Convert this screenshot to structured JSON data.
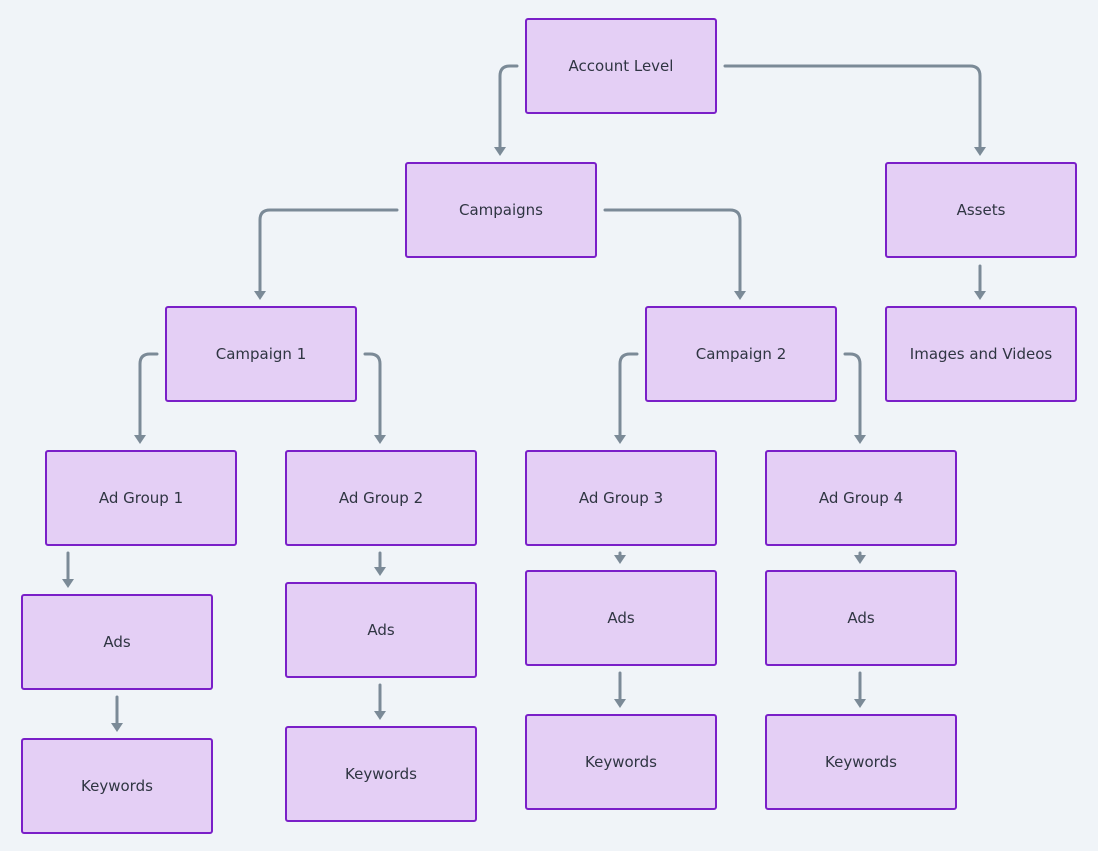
{
  "colors": {
    "background": "#f0f4f8",
    "node_fill": "#e4cff5",
    "node_border": "#7a1fc8",
    "edge": "#7b8a97",
    "text": "#2f3542"
  },
  "nodes": [
    {
      "id": "account",
      "label": "Account Level"
    },
    {
      "id": "campaigns",
      "label": "Campaigns"
    },
    {
      "id": "assets",
      "label": "Assets"
    },
    {
      "id": "campaign1",
      "label": "Campaign 1"
    },
    {
      "id": "campaign2",
      "label": "Campaign 2"
    },
    {
      "id": "images",
      "label": "Images and Videos"
    },
    {
      "id": "adgroup1",
      "label": "Ad Group 1"
    },
    {
      "id": "adgroup2",
      "label": "Ad Group 2"
    },
    {
      "id": "adgroup3",
      "label": "Ad Group 3"
    },
    {
      "id": "adgroup4",
      "label": "Ad Group 4"
    },
    {
      "id": "ads1",
      "label": "Ads"
    },
    {
      "id": "ads2",
      "label": "Ads"
    },
    {
      "id": "ads3",
      "label": "Ads"
    },
    {
      "id": "ads4",
      "label": "Ads"
    },
    {
      "id": "keywords1",
      "label": "Keywords"
    },
    {
      "id": "keywords2",
      "label": "Keywords"
    },
    {
      "id": "keywords3",
      "label": "Keywords"
    },
    {
      "id": "keywords4",
      "label": "Keywords"
    }
  ],
  "edges": [
    {
      "from": "account",
      "to": "campaigns"
    },
    {
      "from": "account",
      "to": "assets"
    },
    {
      "from": "campaigns",
      "to": "campaign1"
    },
    {
      "from": "campaigns",
      "to": "campaign2"
    },
    {
      "from": "assets",
      "to": "images"
    },
    {
      "from": "campaign1",
      "to": "adgroup1"
    },
    {
      "from": "campaign1",
      "to": "adgroup2"
    },
    {
      "from": "campaign2",
      "to": "adgroup3"
    },
    {
      "from": "campaign2",
      "to": "adgroup4"
    },
    {
      "from": "adgroup1",
      "to": "ads1"
    },
    {
      "from": "adgroup2",
      "to": "ads2"
    },
    {
      "from": "adgroup3",
      "to": "ads3"
    },
    {
      "from": "adgroup4",
      "to": "ads4"
    },
    {
      "from": "ads1",
      "to": "keywords1"
    },
    {
      "from": "ads2",
      "to": "keywords2"
    },
    {
      "from": "ads3",
      "to": "keywords3"
    },
    {
      "from": "ads4",
      "to": "keywords4"
    }
  ]
}
